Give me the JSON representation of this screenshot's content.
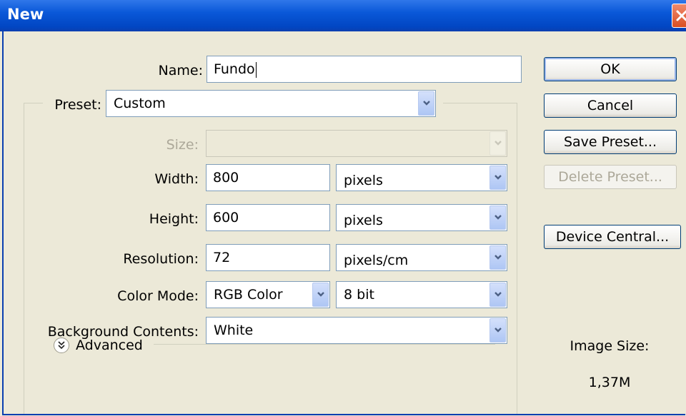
{
  "window": {
    "title": "New"
  },
  "form": {
    "name_label": "Name:",
    "name_value": "Fundo",
    "preset_label": "Preset:",
    "preset_value": "Custom",
    "size_label": "Size:",
    "size_value": "",
    "width_label": "Width:",
    "width_value": "800",
    "width_unit": "pixels",
    "height_label": "Height:",
    "height_value": "600",
    "height_unit": "pixels",
    "resolution_label": "Resolution:",
    "resolution_value": "72",
    "resolution_unit": "pixels/cm",
    "color_mode_label": "Color Mode:",
    "color_mode_value": "RGB Color",
    "bit_depth_value": "8 bit",
    "background_label": "Background Contents:",
    "background_value": "White",
    "advanced_label": "Advanced"
  },
  "buttons": {
    "ok": "OK",
    "cancel": "Cancel",
    "save_preset": "Save Preset...",
    "delete_preset": "Delete Preset...",
    "device_central": "Device Central..."
  },
  "info": {
    "image_size_label": "Image Size:",
    "image_size_value": "1,37M"
  },
  "colors": {
    "titlebar": "#0a58d8",
    "dialog_bg": "#ece9d8",
    "field_border": "#7f9db9",
    "close_button": "#d94f23"
  }
}
